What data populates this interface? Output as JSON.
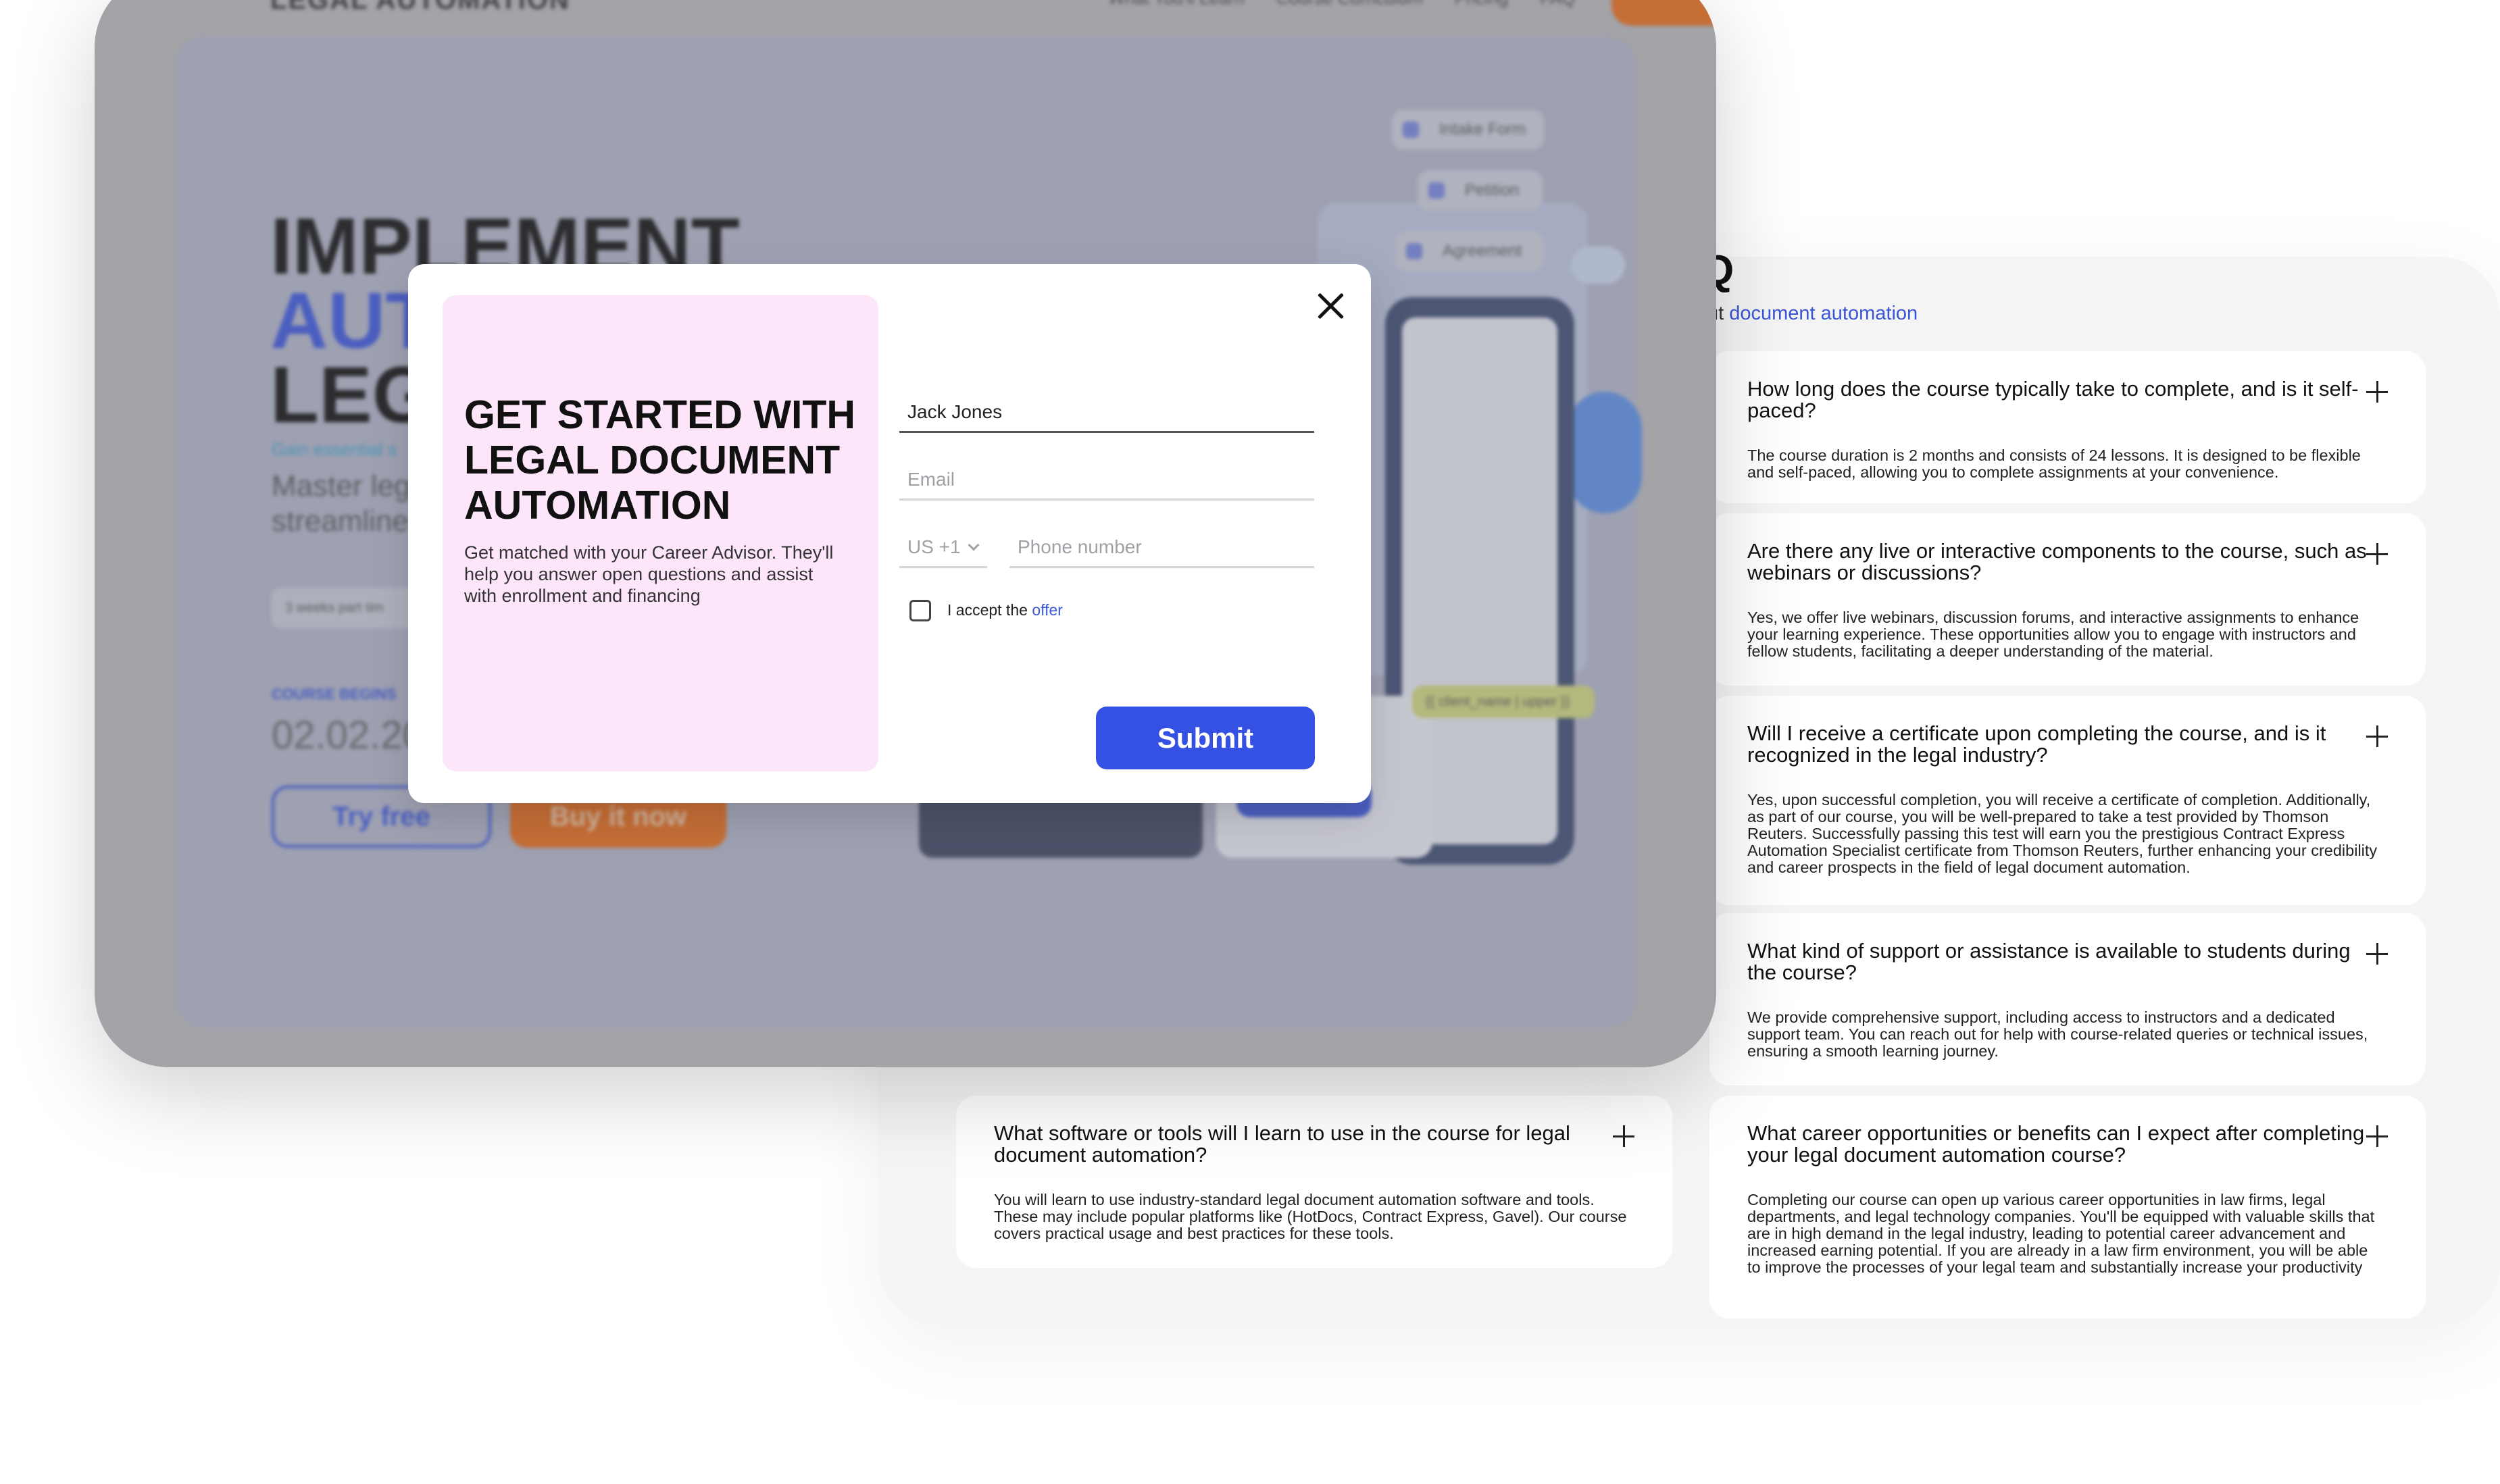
{
  "landing": {
    "logo": "LEGAL AUTOMATION",
    "nav_links": [
      "What You'll Learn",
      "Course Curriculum",
      "Pricing",
      "FAQ"
    ],
    "hero_title_line1": "IMPLEMENT",
    "hero_title_line2": "AUT",
    "hero_title_line3": "LEGA",
    "hero_accent": "Gain essential s",
    "hero_desc": "Master leg streamline boost inco",
    "chip": "3 weeks part tim",
    "course_begins": "COURSE BEGINS",
    "course_date": "02.02.20",
    "try_free": "Try free",
    "buy_now": "Buy it now",
    "pills": [
      "Intake Form",
      "Petition",
      "Agreement"
    ],
    "tag": "{{ client_name | upper }}"
  },
  "faq": {
    "heading": "Q",
    "sub_prefix": "ut ",
    "sub_link": "document automation",
    "items": [
      {
        "q": "How long does the course typically take to complete, and is it self-paced?",
        "a": "The course duration is 2 months and consists of 24 lessons. It is designed to be flexible and self-paced, allowing you to complete assignments at your convenience."
      },
      {
        "q": "Are there any live or interactive components to the course, such as webinars or discussions?",
        "a": "Yes, we offer live webinars, discussion forums, and interactive assignments to enhance your learning experience. These opportunities allow you to engage with instructors and fellow students, facilitating a deeper understanding of the material."
      },
      {
        "q": "Will I receive a certificate upon completing the course, and is it recognized in the legal industry?",
        "a": "Yes, upon successful completion, you will receive a certificate of completion. Additionally, as part of our course, you will be well-prepared to take a test provided by Thomson Reuters. Successfully passing this test will earn you the prestigious Contract Express Automation Specialist certificate from Thomson Reuters, further enhancing your credibility and career prospects in the field of legal document automation."
      },
      {
        "q": "What kind of support or assistance is available to students during the course?",
        "a": "We provide comprehensive support, including access to instructors and a dedicated support team. You can reach out for help with course-related queries or technical issues, ensuring a smooth learning journey."
      },
      {
        "q": "What career opportunities or benefits can I expect after completing your legal document automation course?",
        "a": "Completing our course can open up various career opportunities in law firms, legal departments, and legal technology companies. You'll be equipped with valuable skills that are in high demand in the legal industry, leading to potential career advancement and increased earning potential. If you are already in a law firm environment, you will be able to improve the processes of your legal team and substantially increase your productivity"
      },
      {
        "q": "What software or tools will I learn to use in the course for legal document automation?",
        "a": "You will learn to use industry-standard legal document automation software and tools. These may include popular platforms like (HotDocs, Contract Express, Gavel). Our course covers practical usage and best practices for these tools."
      }
    ]
  },
  "modal": {
    "title": "GET STARTED WITH LEGAL DOCUMENT AUTOMATION",
    "description": "Get matched with your Career Advisor. They'll help you answer open questions and assist with enrollment and financing",
    "name_value": "Jack Jones",
    "email_placeholder": "Email",
    "country_code": "US +1",
    "phone_placeholder": "Phone number",
    "accept_prefix": "I accept the ",
    "accept_link": "offer",
    "submit_label": "Submit"
  }
}
